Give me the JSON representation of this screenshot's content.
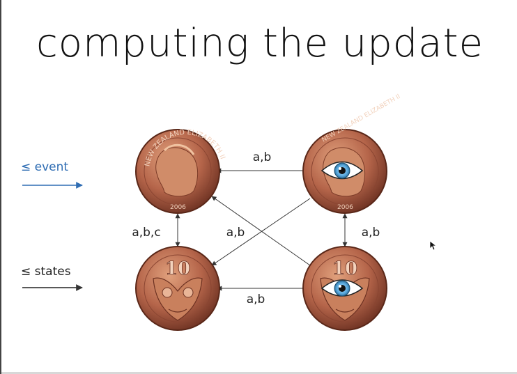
{
  "title": "computing the update",
  "legend": {
    "event_label": "≤ event",
    "states_label": "≤ states",
    "event_color": "#2f6db3",
    "states_color": "#222222"
  },
  "nodes": [
    {
      "id": "queen",
      "kind": "coin-queen"
    },
    {
      "id": "queen-eye",
      "kind": "coin-queen-eye"
    },
    {
      "id": "ten",
      "kind": "coin-ten"
    },
    {
      "id": "ten-eye",
      "kind": "coin-ten-eye"
    }
  ],
  "coin_text": {
    "queen_inscription": "NEW ZEALAND ELIZABETH II",
    "queen_year": "2006",
    "ten_value": "10"
  },
  "edges": [
    {
      "from": "queen-eye",
      "to": "queen",
      "label": "a,b"
    },
    {
      "from": "queen",
      "to": "ten",
      "label": "a,b,c",
      "bidirectional": true
    },
    {
      "from": "queen-eye",
      "to": "ten-eye",
      "label": "a,b",
      "bidirectional": true
    },
    {
      "from": "queen-eye",
      "to": "ten",
      "label": "a,b"
    },
    {
      "from": "ten-eye",
      "to": "queen",
      "label": ""
    },
    {
      "from": "ten-eye",
      "to": "ten",
      "label": "a,b"
    }
  ],
  "colors": {
    "coin_copper": "#b5654a",
    "coin_dark": "#6b3021",
    "eye_iris": "#5aa9de"
  }
}
